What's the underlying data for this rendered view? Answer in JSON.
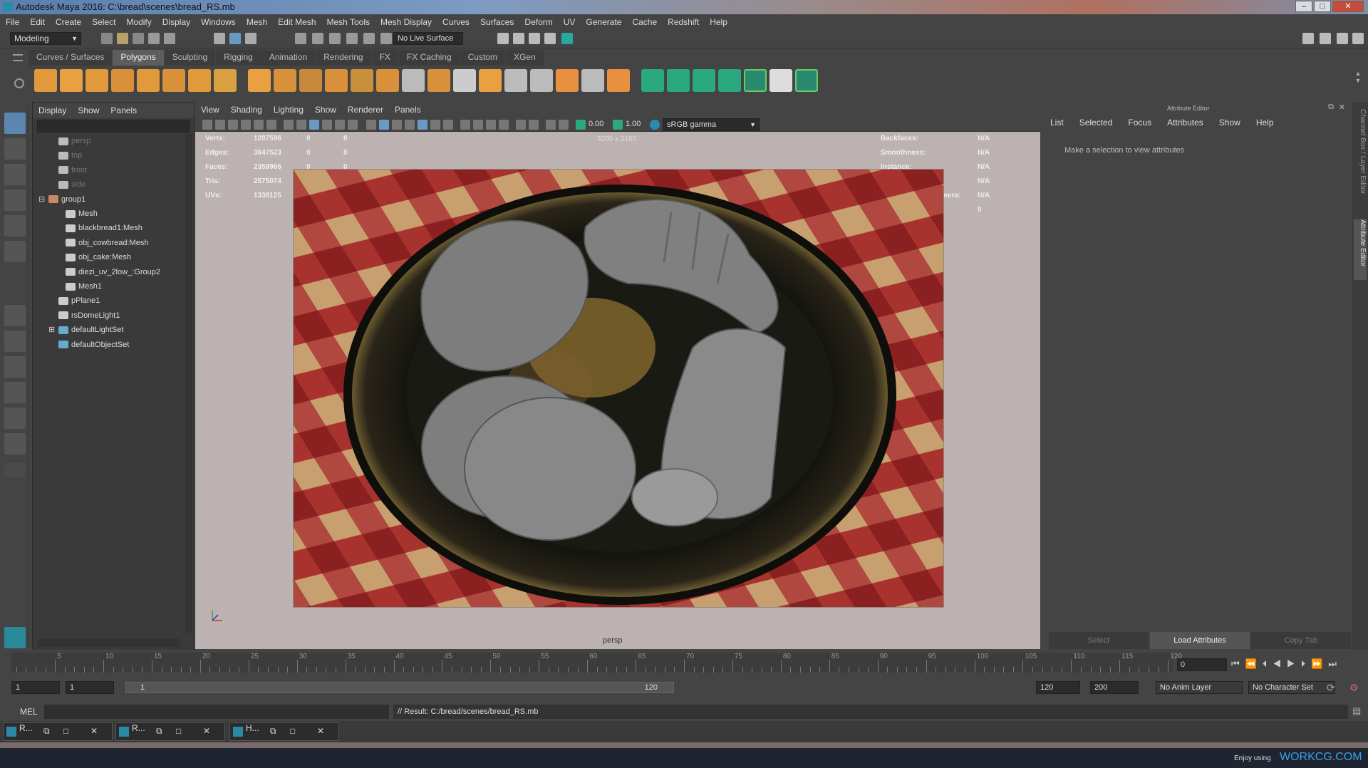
{
  "window": {
    "title": "Autodesk Maya 2016: C:\\bread\\scenes\\bread_RS.mb"
  },
  "menubar": [
    "File",
    "Edit",
    "Create",
    "Select",
    "Modify",
    "Display",
    "Windows",
    "Mesh",
    "Edit Mesh",
    "Mesh Tools",
    "Mesh Display",
    "Curves",
    "Surfaces",
    "Deform",
    "UV",
    "Generate",
    "Cache",
    "Redshift",
    "Help"
  ],
  "statusline": {
    "mode": "Modeling",
    "live_surface": "No Live Surface"
  },
  "shelf_tabs": [
    "Curves / Surfaces",
    "Polygons",
    "Sculpting",
    "Rigging",
    "Animation",
    "Rendering",
    "FX",
    "FX Caching",
    "Custom",
    "XGen"
  ],
  "shelf_active": "Polygons",
  "outliner": {
    "menu": [
      "Display",
      "Show",
      "Panels"
    ],
    "items": [
      {
        "label": "persp",
        "dim": true
      },
      {
        "label": "top",
        "dim": true
      },
      {
        "label": "front",
        "dim": true
      },
      {
        "label": "side",
        "dim": true
      },
      {
        "label": "group1",
        "dim": false
      },
      {
        "label": "Mesh",
        "dim": false
      },
      {
        "label": "blackbread1:Mesh",
        "dim": false
      },
      {
        "label": "obj_cowbread:Mesh",
        "dim": false
      },
      {
        "label": "obj_cake:Mesh",
        "dim": false
      },
      {
        "label": "diezi_uv_2low_:Group2",
        "dim": false
      },
      {
        "label": "Mesh1",
        "dim": false
      },
      {
        "label": "pPlane1",
        "dim": false
      },
      {
        "label": "rsDomeLight1",
        "dim": false
      },
      {
        "label": "defaultLightSet",
        "dim": false
      },
      {
        "label": "defaultObjectSet",
        "dim": false
      }
    ]
  },
  "viewport": {
    "menu": [
      "View",
      "Shading",
      "Lighting",
      "Show",
      "Renderer",
      "Panels"
    ],
    "exposure": "0.00",
    "gamma": "1.00",
    "colorspace": "sRGB gamma",
    "resolution": "3200 x 2160",
    "camera": "persp",
    "hud_left": [
      {
        "label": "Verts:",
        "a": "1287596",
        "b": "0",
        "c": "0"
      },
      {
        "label": "Edges:",
        "a": "3647523",
        "b": "0",
        "c": "0"
      },
      {
        "label": "Faces:",
        "a": "2359966",
        "b": "0",
        "c": "0"
      },
      {
        "label": "Tris:",
        "a": "2575074",
        "b": "0",
        "c": "0"
      },
      {
        "label": "UVs:",
        "a": "1338125",
        "b": "0",
        "c": "0"
      }
    ],
    "hud_right": [
      {
        "label": "Backfaces:",
        "value": "N/A"
      },
      {
        "label": "Smoothness:",
        "value": "N/A"
      },
      {
        "label": "Instance:",
        "value": "N/A"
      },
      {
        "label": "Display Layer:",
        "value": "N/A"
      },
      {
        "label": "Distance From Camera:",
        "value": "N/A"
      },
      {
        "label": "Selected Objects:",
        "value": "0"
      }
    ]
  },
  "attribute_editor": {
    "title": "Attribute Editor",
    "menu": [
      "List",
      "Selected",
      "Focus",
      "Attributes",
      "Show",
      "Help"
    ],
    "message": "Make a selection to view attributes",
    "buttons": [
      "Select",
      "Load Attributes",
      "Copy Tab"
    ],
    "side_tabs": [
      "Channel Box / Layer Editor",
      "Attribute Editor"
    ]
  },
  "timeline": {
    "ticks": [
      "5",
      "10",
      "15",
      "20",
      "25",
      "30",
      "35",
      "40",
      "45",
      "50",
      "55",
      "60",
      "65",
      "70",
      "75",
      "80",
      "85",
      "90",
      "95",
      "100",
      "105",
      "110",
      "115",
      "120"
    ],
    "current_frame": "0"
  },
  "range": {
    "start": "1",
    "inner_start": "1",
    "slider_start": "1",
    "slider_end": "120",
    "end": "120",
    "max": "200",
    "anim_layer": "No Anim Layer",
    "character_set": "No Character Set"
  },
  "command": {
    "label": "MEL",
    "result": "// Result: C:/bread/scenes/bread_RS.mb"
  },
  "taskbar": {
    "items": [
      "R...",
      "R...",
      "H..."
    ],
    "watermark_prefix": "Enjoy using",
    "watermark": "WORKCG.COM"
  }
}
